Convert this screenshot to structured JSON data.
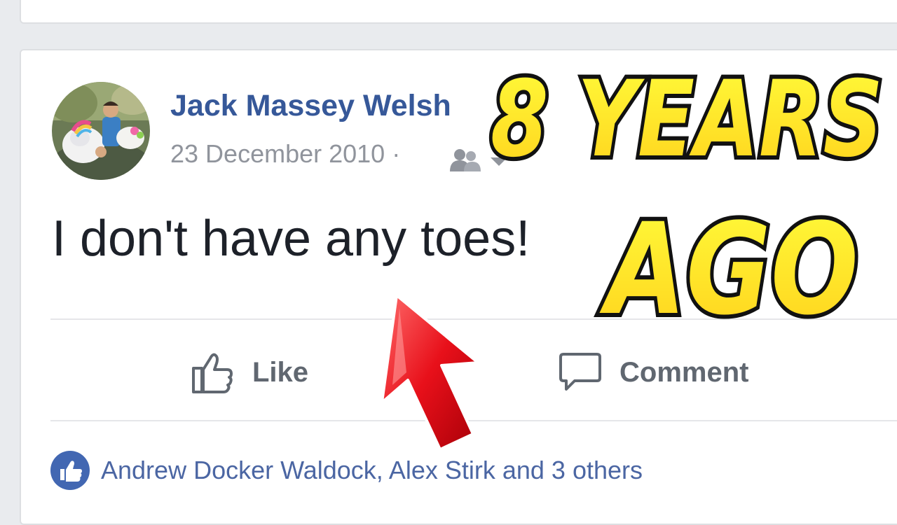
{
  "post": {
    "author": "Jack Massey Welsh",
    "date": "23 December 2010",
    "separator": "·",
    "audience_icon": "friends-icon",
    "text": "I don't have any toes!"
  },
  "actions": {
    "like_label": "Like",
    "comment_label": "Comment"
  },
  "reactions": {
    "summary": "Andrew Docker Waldock, Alex Stirk and 3 others",
    "icon": "like-reaction-icon"
  },
  "overlay": {
    "line1": "8 YEARS",
    "line2": "AGO"
  },
  "colors": {
    "author_link": "#365899",
    "overlay_fill": "#fff200",
    "arrow": "#e8101a",
    "like_blue": "#4267b2"
  }
}
